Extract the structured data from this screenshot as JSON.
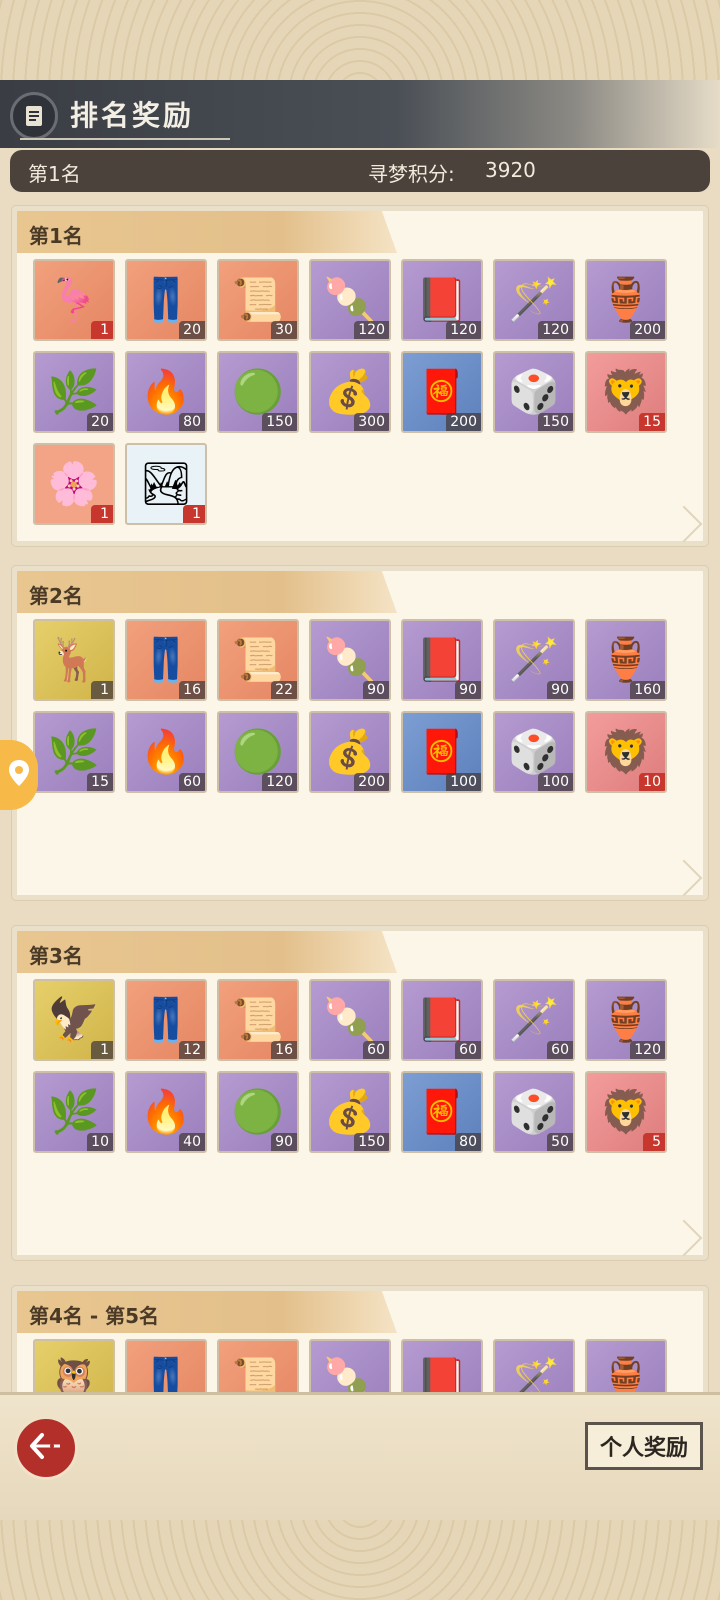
{
  "header": {
    "title": "排名奖励",
    "icon": "scroll-icon"
  },
  "score_bar": {
    "rank": "第1名",
    "label": "寻梦积分:",
    "value": "3920"
  },
  "tiers": [
    {
      "label": "第1名",
      "items": [
        {
          "icon": "crane-portrait-icon",
          "qty": "1",
          "color": "orange",
          "glyph": "🦩",
          "red": true
        },
        {
          "icon": "green-leggings-icon",
          "qty": "20",
          "color": "orange",
          "glyph": "👖",
          "red": false
        },
        {
          "icon": "scroll-painting-icon",
          "qty": "30",
          "color": "orange",
          "glyph": "📜",
          "red": false
        },
        {
          "icon": "rice-balls-icon",
          "qty": "120",
          "color": "purple",
          "glyph": "🍡",
          "red": false
        },
        {
          "icon": "book-icon",
          "qty": "120",
          "color": "purple",
          "glyph": "📕",
          "red": false
        },
        {
          "icon": "jade-ruyi-icon",
          "qty": "120",
          "color": "purple",
          "glyph": "🪄",
          "red": false
        },
        {
          "icon": "bronze-vessel-icon",
          "qty": "200",
          "color": "purple",
          "glyph": "🏺",
          "red": false
        },
        {
          "icon": "gourd-plant-icon",
          "qty": "20",
          "color": "purple",
          "glyph": "🌿",
          "red": false
        },
        {
          "icon": "fire-orb-icon",
          "qty": "80",
          "color": "purple",
          "glyph": "🔥",
          "red": false
        },
        {
          "icon": "jade-disc-icon",
          "qty": "150",
          "color": "purple",
          "glyph": "🟢",
          "red": false
        },
        {
          "icon": "money-bag-icon",
          "qty": "300",
          "color": "purple",
          "glyph": "💰",
          "red": false
        },
        {
          "icon": "red-pouch-icon",
          "qty": "200",
          "color": "blue",
          "glyph": "🧧",
          "red": false
        },
        {
          "icon": "game-board-icon",
          "qty": "150",
          "color": "purple",
          "glyph": "🎲",
          "red": false
        },
        {
          "icon": "lion-statue-icon",
          "qty": "15",
          "color": "red",
          "glyph": "🦁",
          "red": true
        },
        {
          "icon": "floral-frame-icon",
          "qty": "1",
          "color": "frame",
          "glyph": "🌸",
          "red": true
        },
        {
          "icon": "landscape-frame-icon",
          "qty": "1",
          "color": "frame2",
          "glyph": "🏞",
          "red": true
        }
      ]
    },
    {
      "label": "第2名",
      "items": [
        {
          "icon": "white-deer-portrait-icon",
          "qty": "1",
          "color": "gold",
          "glyph": "🦌",
          "red": false
        },
        {
          "icon": "green-leggings-icon",
          "qty": "16",
          "color": "orange",
          "glyph": "👖",
          "red": false
        },
        {
          "icon": "scroll-painting-icon",
          "qty": "22",
          "color": "orange",
          "glyph": "📜",
          "red": false
        },
        {
          "icon": "rice-balls-icon",
          "qty": "90",
          "color": "purple",
          "glyph": "🍡",
          "red": false
        },
        {
          "icon": "book-icon",
          "qty": "90",
          "color": "purple",
          "glyph": "📕",
          "red": false
        },
        {
          "icon": "jade-ruyi-icon",
          "qty": "90",
          "color": "purple",
          "glyph": "🪄",
          "red": false
        },
        {
          "icon": "bronze-vessel-icon",
          "qty": "160",
          "color": "purple",
          "glyph": "🏺",
          "red": false
        },
        {
          "icon": "gourd-plant-icon",
          "qty": "15",
          "color": "purple",
          "glyph": "🌿",
          "red": false
        },
        {
          "icon": "fire-orb-icon",
          "qty": "60",
          "color": "purple",
          "glyph": "🔥",
          "red": false
        },
        {
          "icon": "jade-disc-icon",
          "qty": "120",
          "color": "purple",
          "glyph": "🟢",
          "red": false
        },
        {
          "icon": "money-bag-icon",
          "qty": "200",
          "color": "purple",
          "glyph": "💰",
          "red": false
        },
        {
          "icon": "red-pouch-icon",
          "qty": "100",
          "color": "blue",
          "glyph": "🧧",
          "red": false
        },
        {
          "icon": "game-board-icon",
          "qty": "100",
          "color": "purple",
          "glyph": "🎲",
          "red": false
        },
        {
          "icon": "lion-statue-icon",
          "qty": "10",
          "color": "red",
          "glyph": "🦁",
          "red": true
        }
      ]
    },
    {
      "label": "第3名",
      "items": [
        {
          "icon": "blue-bird-portrait-icon",
          "qty": "1",
          "color": "gold",
          "glyph": "🦅",
          "red": false
        },
        {
          "icon": "green-leggings-icon",
          "qty": "12",
          "color": "orange",
          "glyph": "👖",
          "red": false
        },
        {
          "icon": "scroll-painting-icon",
          "qty": "16",
          "color": "orange",
          "glyph": "📜",
          "red": false
        },
        {
          "icon": "rice-balls-icon",
          "qty": "60",
          "color": "purple",
          "glyph": "🍡",
          "red": false
        },
        {
          "icon": "book-icon",
          "qty": "60",
          "color": "purple",
          "glyph": "📕",
          "red": false
        },
        {
          "icon": "jade-ruyi-icon",
          "qty": "60",
          "color": "purple",
          "glyph": "🪄",
          "red": false
        },
        {
          "icon": "bronze-vessel-icon",
          "qty": "120",
          "color": "purple",
          "glyph": "🏺",
          "red": false
        },
        {
          "icon": "gourd-plant-icon",
          "qty": "10",
          "color": "purple",
          "glyph": "🌿",
          "red": false
        },
        {
          "icon": "fire-orb-icon",
          "qty": "40",
          "color": "purple",
          "glyph": "🔥",
          "red": false
        },
        {
          "icon": "jade-disc-icon",
          "qty": "90",
          "color": "purple",
          "glyph": "🟢",
          "red": false
        },
        {
          "icon": "money-bag-icon",
          "qty": "150",
          "color": "purple",
          "glyph": "💰",
          "red": false
        },
        {
          "icon": "red-pouch-icon",
          "qty": "80",
          "color": "blue",
          "glyph": "🧧",
          "red": false
        },
        {
          "icon": "game-board-icon",
          "qty": "50",
          "color": "purple",
          "glyph": "🎲",
          "red": false
        },
        {
          "icon": "lion-statue-icon",
          "qty": "5",
          "color": "red",
          "glyph": "🦁",
          "red": true
        }
      ]
    },
    {
      "label": "第4名 - 第5名",
      "items": [
        {
          "icon": "owl-portrait-icon",
          "qty": "",
          "color": "gold",
          "glyph": "🦉",
          "red": false
        },
        {
          "icon": "green-leggings-icon",
          "qty": "",
          "color": "orange",
          "glyph": "👖",
          "red": false
        },
        {
          "icon": "scroll-painting-icon",
          "qty": "",
          "color": "orange",
          "glyph": "📜",
          "red": false
        },
        {
          "icon": "rice-balls-icon",
          "qty": "",
          "color": "purple",
          "glyph": "🍡",
          "red": false
        },
        {
          "icon": "book-icon",
          "qty": "",
          "color": "purple",
          "glyph": "📕",
          "red": false
        },
        {
          "icon": "jade-ruyi-icon",
          "qty": "",
          "color": "purple",
          "glyph": "🪄",
          "red": false
        },
        {
          "icon": "bronze-vessel-icon",
          "qty": "",
          "color": "purple",
          "glyph": "🏺",
          "red": false
        }
      ]
    }
  ],
  "footer": {
    "back_icon": "back-arrow-icon",
    "personal_reward_label": "个人奖励"
  },
  "side_tab_icon": "location-pin-icon"
}
